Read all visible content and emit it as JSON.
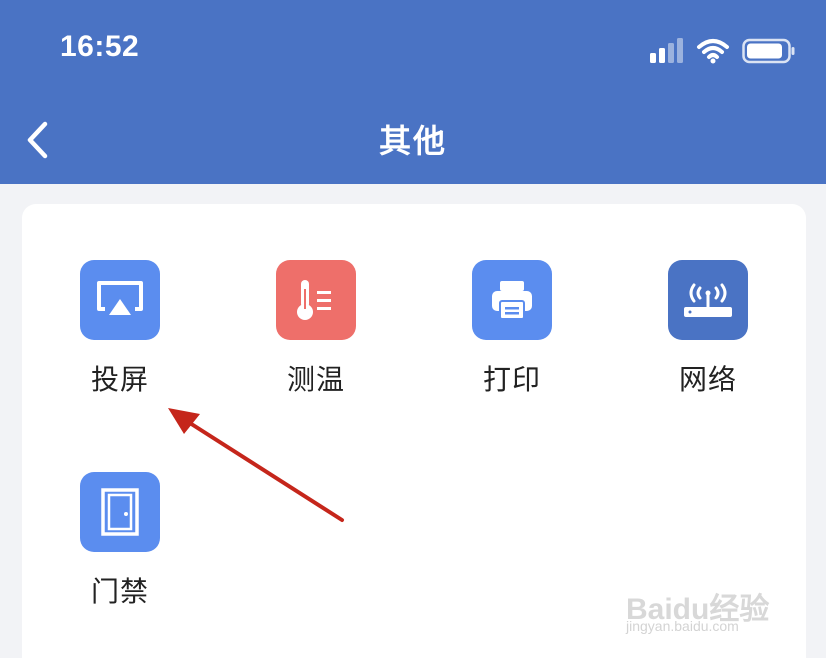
{
  "status_bar": {
    "time": "16:52"
  },
  "nav": {
    "title": "其他"
  },
  "grid": {
    "items": [
      {
        "label": "投屏",
        "icon": "screen-cast-icon",
        "color": "#5B8DEF"
      },
      {
        "label": "测温",
        "icon": "thermometer-icon",
        "color": "#EE6F6A"
      },
      {
        "label": "打印",
        "icon": "printer-icon",
        "color": "#5B8DEF"
      },
      {
        "label": "网络",
        "icon": "router-icon",
        "color": "#4A73C4"
      },
      {
        "label": "门禁",
        "icon": "door-icon",
        "color": "#5B8DEF"
      }
    ]
  },
  "watermark": {
    "logo": "Baidu经验",
    "url": "jingyan.baidu.com"
  }
}
